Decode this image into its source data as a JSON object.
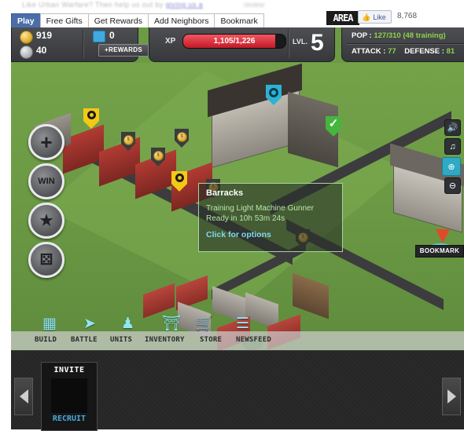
{
  "browser": {
    "strip_text": "Like Urban Warfare? Then help us out by",
    "strip_link": "giving us a",
    "strip_tail": "review"
  },
  "social": {
    "logo_text": "AREA",
    "like_label": "Like",
    "like_icon": "thumbs-up-icon",
    "like_count": "8,768"
  },
  "tabs": [
    {
      "label": "Play",
      "active": true
    },
    {
      "label": "Free Gifts",
      "active": false
    },
    {
      "label": "Get Rewards",
      "active": false
    },
    {
      "label": "Add Neighbors",
      "active": false
    },
    {
      "label": "Bookmark",
      "active": false
    }
  ],
  "hud": {
    "gold": "919",
    "silver": "40",
    "gems": "0",
    "rewards_label": "+REWARDS",
    "xp_label": "XP",
    "xp_text": "1,105/1,226",
    "xp_percent": 90,
    "level_label": "LVL.",
    "level_value": "5",
    "pop_label": "POP :",
    "pop_value": "127/310 (48 training)",
    "attack_label": "ATTACK :",
    "attack_value": "77",
    "defense_label": "DEFENSE :",
    "defense_value": "81"
  },
  "tooltip": {
    "title": "Barracks",
    "line1": "Training Light Machine Gunner",
    "line2": "Ready in 10h 53m 24s",
    "action": "Click for options"
  },
  "side_buttons": [
    {
      "name": "add-button",
      "glyph": "+"
    },
    {
      "name": "win-button",
      "glyph": "WIN"
    },
    {
      "name": "favorites-button",
      "glyph": "★"
    },
    {
      "name": "dice-button",
      "glyph": "⚄"
    }
  ],
  "right_controls": [
    {
      "name": "sound-icon",
      "glyph": "◀)"
    },
    {
      "name": "music-icon",
      "glyph": "♫"
    },
    {
      "name": "zoom-in-icon",
      "glyph": "⊕"
    },
    {
      "name": "zoom-out-icon",
      "glyph": "⊖"
    }
  ],
  "bookmark": {
    "label": "BOOKMARK"
  },
  "nav": [
    {
      "label": "BUILD",
      "icon": "blocks-icon",
      "glyph": "⬚"
    },
    {
      "label": "BATTLE",
      "icon": "pistol-icon",
      "glyph": "➤"
    },
    {
      "label": "UNITS",
      "icon": "soldier-icon",
      "glyph": "♟"
    },
    {
      "label": "INVENTORY",
      "icon": "chest-icon",
      "glyph": "⛁"
    },
    {
      "label": "STORE",
      "icon": "cart-icon",
      "glyph": "Ὥ2"
    },
    {
      "label": "NEWSFEED",
      "icon": "list-icon",
      "glyph": "☰"
    }
  ],
  "bottom": {
    "invite_title": "INVITE",
    "invite_sub": "RECRUIT",
    "prev_icon": "arrow-left-icon",
    "next_icon": "arrow-right-icon"
  },
  "colors": {
    "accent_blue": "#4a6ea8",
    "xp_red": "#c11b27",
    "grass": "#6d9b45",
    "marker_yellow": "#f4c816",
    "marker_green": "#46b53e",
    "marker_teal": "#2bb3d6",
    "nav_cyan": "#8fe6f5"
  }
}
